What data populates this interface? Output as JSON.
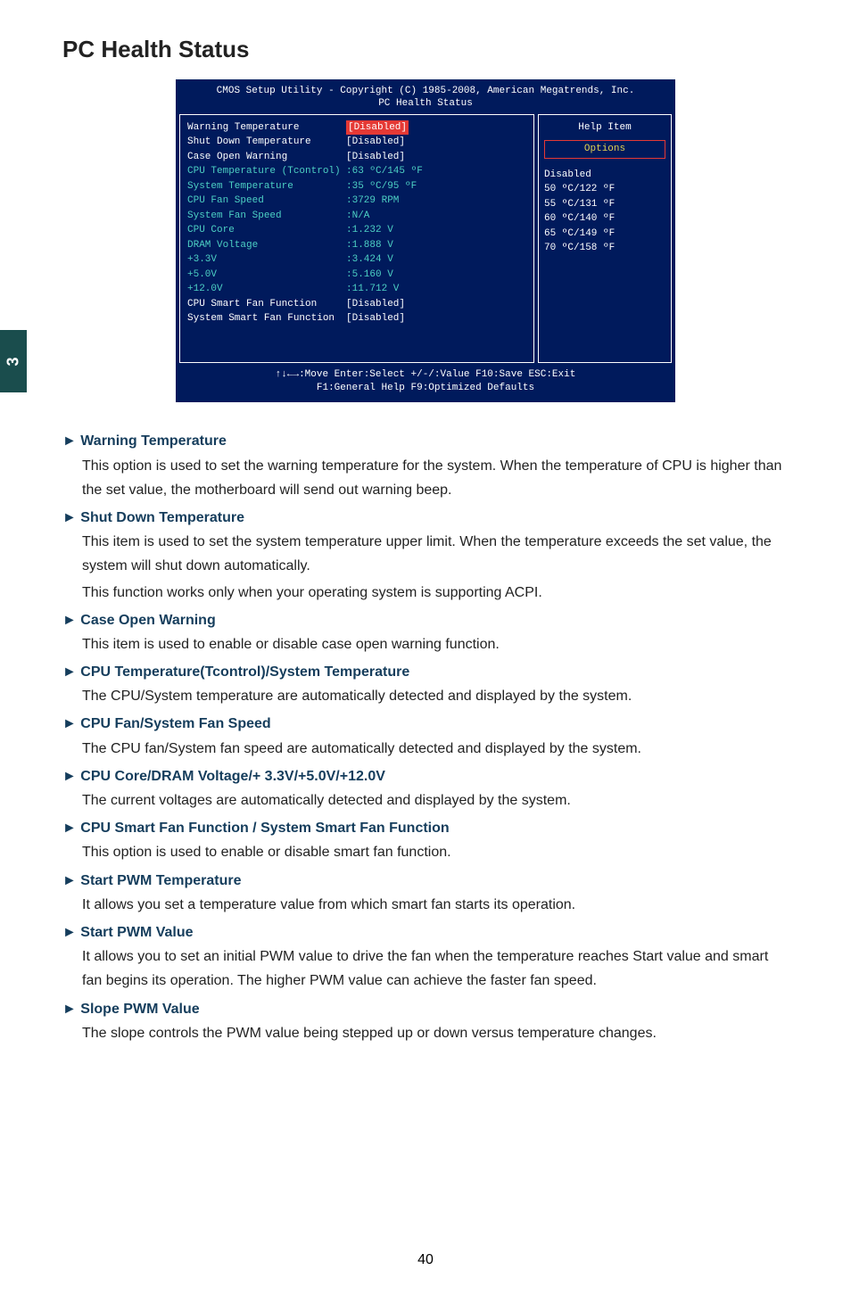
{
  "side_tab": "3",
  "page_title": "PC Health Status",
  "bios": {
    "header_line1": "CMOS Setup Utility - Copyright (C) 1985-2008, American Megatrends, Inc.",
    "header_line2": "PC Health Status",
    "rows": [
      {
        "label": "Warning Temperature",
        "value": "[Disabled]",
        "label_class": "white-text",
        "value_class": "highlight"
      },
      {
        "label": "Shut Down Temperature",
        "value": "[Disabled]",
        "label_class": "white-text",
        "value_class": "white-text"
      },
      {
        "label": "Case Open Warning",
        "value": "[Disabled]",
        "label_class": "white-text",
        "value_class": "white-text"
      },
      {
        "label": "CPU Temperature (Tcontrol)",
        "value": ":63 ºC/145 ºF",
        "label_class": "teal-text",
        "value_class": "teal-text"
      },
      {
        "label": "System Temperature",
        "value": ":35 ºC/95 ºF",
        "label_class": "teal-text",
        "value_class": "teal-text"
      },
      {
        "label": "CPU Fan Speed",
        "value": ":3729 RPM",
        "label_class": "teal-text",
        "value_class": "teal-text"
      },
      {
        "label": "System Fan Speed",
        "value": ":N/A",
        "label_class": "teal-text",
        "value_class": "teal-text"
      },
      {
        "label": "CPU Core",
        "value": ":1.232 V",
        "label_class": "teal-text",
        "value_class": "teal-text"
      },
      {
        "label": "DRAM Voltage",
        "value": ":1.888 V",
        "label_class": "teal-text",
        "value_class": "teal-text"
      },
      {
        "label": "+3.3V",
        "value": ":3.424 V",
        "label_class": "teal-text",
        "value_class": "teal-text"
      },
      {
        "label": "+5.0V",
        "value": ":5.160 V",
        "label_class": "teal-text",
        "value_class": "teal-text"
      },
      {
        "label": "+12.0V",
        "value": ":11.712 V",
        "label_class": "teal-text",
        "value_class": "teal-text"
      },
      {
        "label": "CPU Smart Fan Function",
        "value": "[Disabled]",
        "label_class": "white-text",
        "value_class": "white-text"
      },
      {
        "label": "System Smart Fan Function",
        "value": "[Disabled]",
        "label_class": "white-text",
        "value_class": "white-text"
      }
    ],
    "right": {
      "help_item": "Help Item",
      "options": "Options",
      "values": [
        "Disabled",
        "50 ºC/122 ºF",
        "55 ºC/131 ºF",
        "60 ºC/140 ºF",
        "65 ºC/149 ºF",
        "70 ºC/158 ºF"
      ]
    },
    "footer_line1": "↑↓←→:Move   Enter:Select    +/-/:Value    F10:Save       ESC:Exit",
    "footer_line2": "F1:General Help                            F9:Optimized Defaults"
  },
  "sections": [
    {
      "title": "► Warning Temperature",
      "body": [
        "This option is used to set the warning temperature for the system. When the temperature of CPU is higher than the set value, the motherboard will send out warning beep."
      ]
    },
    {
      "title": "► Shut Down Temperature",
      "body": [
        "This item is used to set the system temperature upper limit. When the temperature exceeds the set value, the system will shut down automatically.",
        "This function works only when your operating system is supporting ACPI."
      ]
    },
    {
      "title": "► Case Open Warning",
      "body": [
        "This item is used to enable or disable case open warning function."
      ]
    },
    {
      "title": "► CPU Temperature(Tcontrol)/System Temperature",
      "body": [
        "The CPU/System temperature are automatically detected and displayed by the system."
      ]
    },
    {
      "title": "► CPU Fan/System Fan Speed",
      "body": [
        "The CPU fan/System fan speed are automatically detected and displayed by the system."
      ]
    },
    {
      "title": "► CPU Core/DRAM Voltage/+ 3.3V/+5.0V/+12.0V",
      "body": [
        "The current voltages are automatically detected and displayed by the system."
      ]
    },
    {
      "title": "► CPU Smart Fan Function / System Smart Fan Function",
      "body": [
        "This option is used to enable or disable smart fan function."
      ]
    },
    {
      "title": "► Start PWM Temperature",
      "body": [
        "It allows you set a temperature value from which smart fan starts its operation."
      ]
    },
    {
      "title": "► Start PWM Value",
      "body": [
        "It allows you to set an initial PWM value to drive the fan when the temperature reaches Start value and smart fan begins its operation. The higher PWM value can achieve the faster fan speed."
      ]
    },
    {
      "title": "► Slope PWM Value",
      "body": [
        "The slope controls the PWM value being stepped up or down versus temperature changes."
      ]
    }
  ],
  "page_number": "40"
}
